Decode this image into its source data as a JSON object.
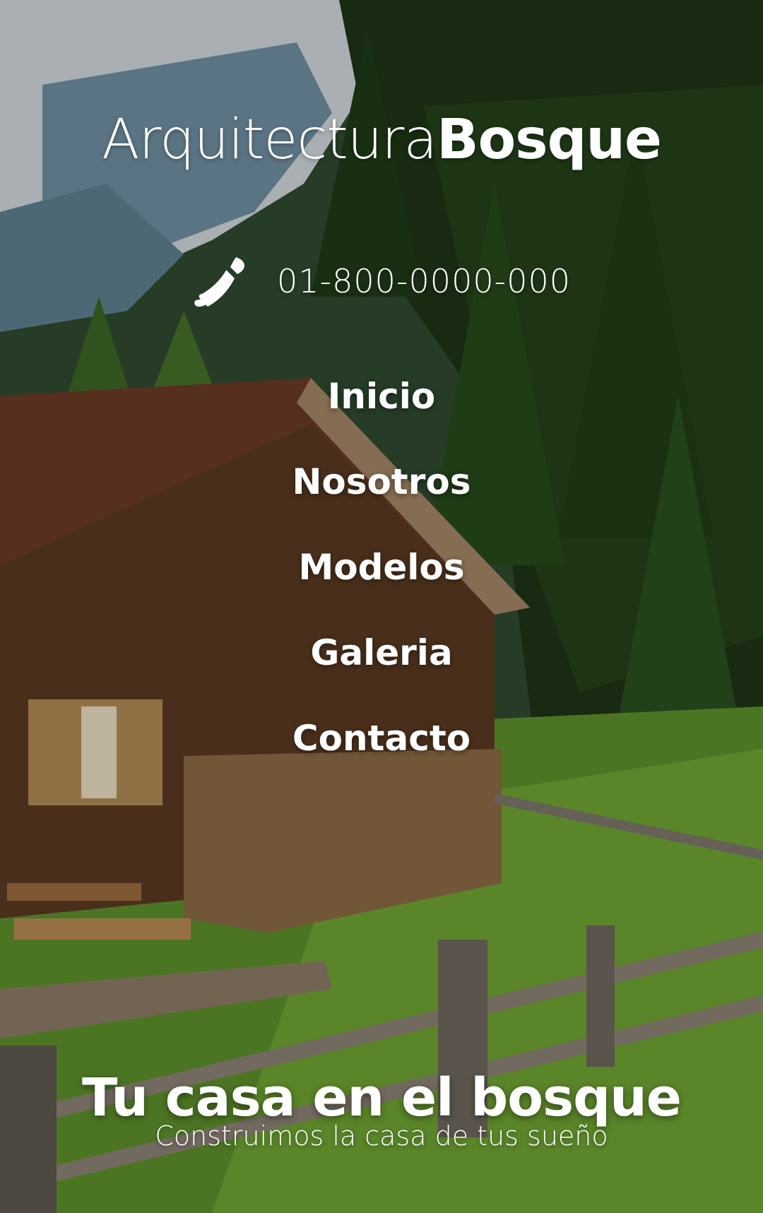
{
  "brand": {
    "light": "Arquitectura",
    "bold": "Bosque"
  },
  "contact": {
    "icon": "phone-icon",
    "phone": "01-800-0000-000"
  },
  "nav": {
    "items": [
      {
        "label": "Inicio"
      },
      {
        "label": "Nosotros"
      },
      {
        "label": "Modelos"
      },
      {
        "label": "Galeria"
      },
      {
        "label": "Contacto"
      }
    ]
  },
  "hero": {
    "title": "Tu casa en el bosque",
    "subtitle": "Construimos la casa de tus sueño"
  },
  "colors": {
    "text": "#ffffff",
    "forest_dark": "#1f3a1c",
    "grass": "#6a9a2a",
    "wood": "#7a4f2a",
    "snow": "#d8dde0"
  }
}
